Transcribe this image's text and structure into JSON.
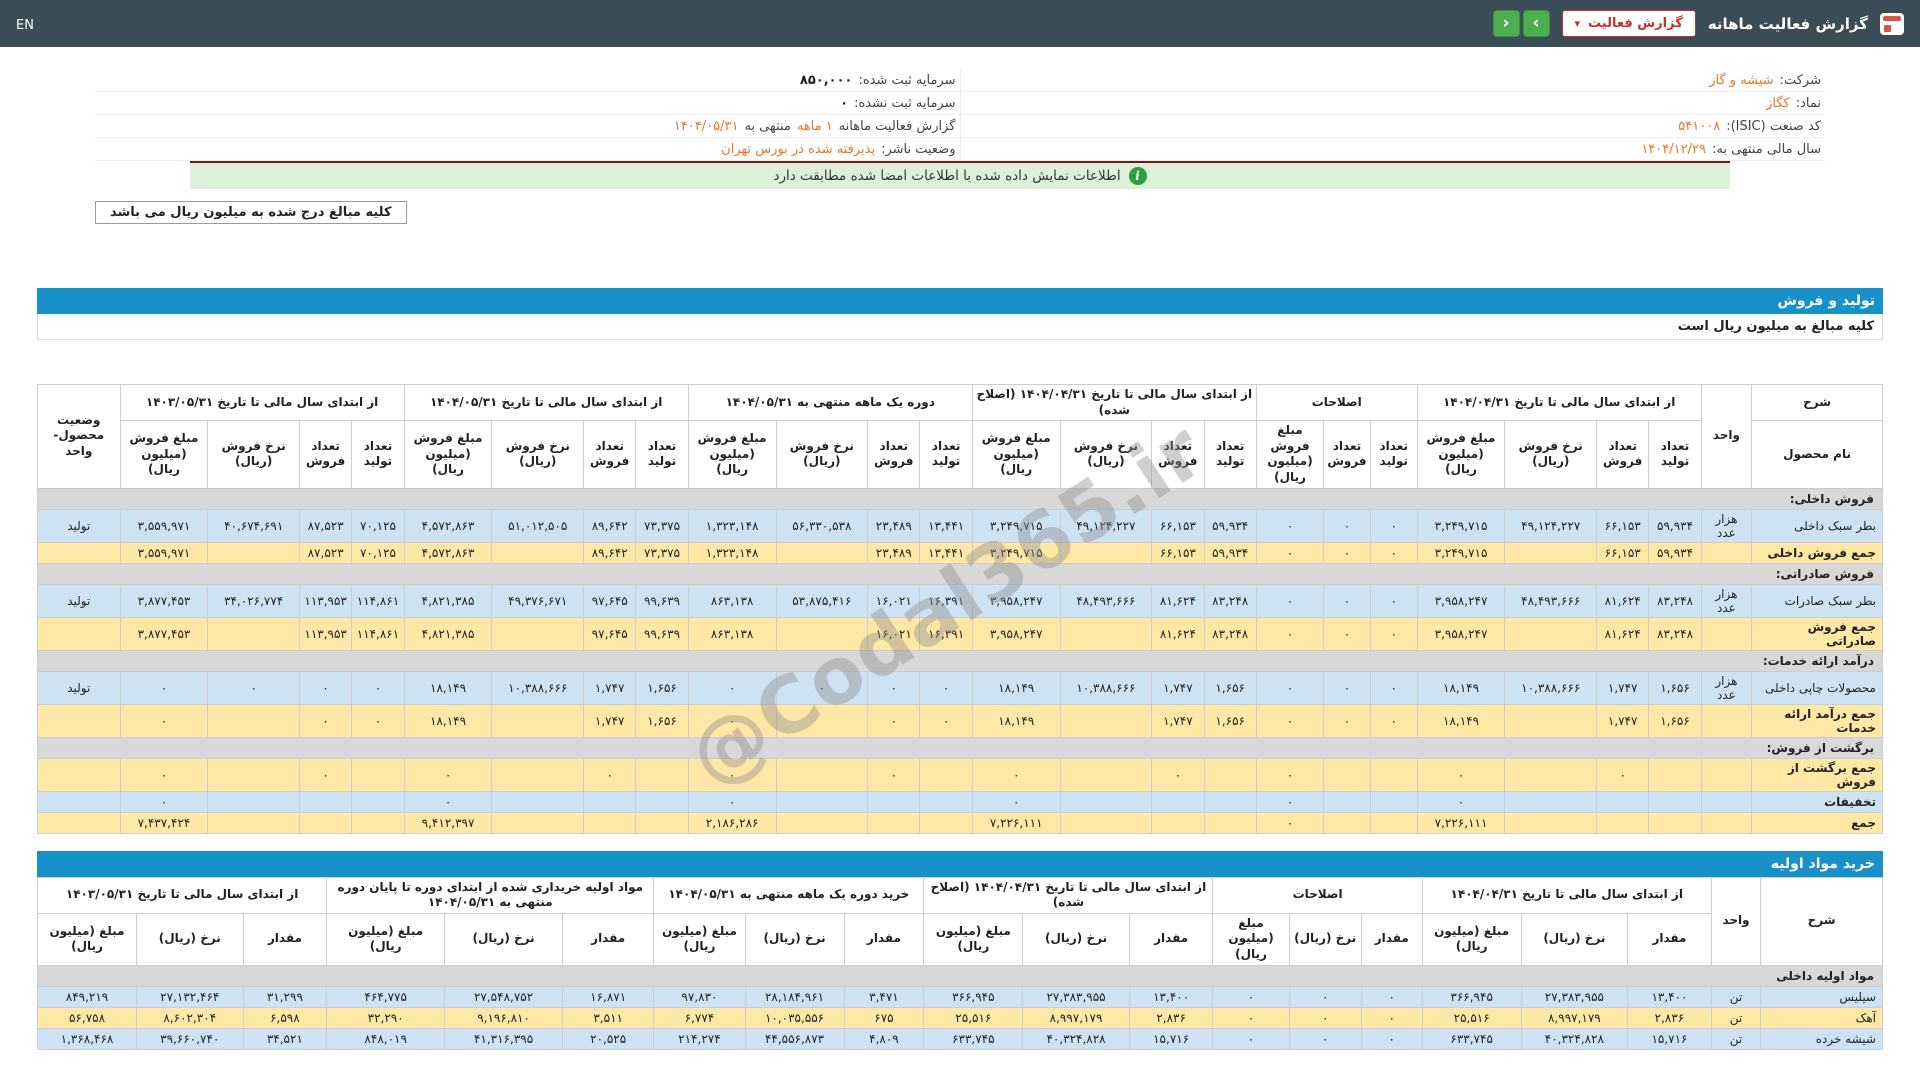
{
  "navbar": {
    "title": "گزارش فعالیت ماهانه",
    "report_button": "گزارش فعالیت",
    "caret": "▾",
    "next": "›",
    "prev": "‹",
    "lang": "EN"
  },
  "company": {
    "name_label": "شرکت:",
    "name": "شیشه و گاز",
    "symbol_label": "نماد:",
    "symbol": "کگاز",
    "isic_label": "کد صنعت (ISIC):",
    "isic": "۵۴۱۰۰۸",
    "fiscal_label": "سال مالی منتهی به:",
    "fiscal": "۱۴۰۴/۱۲/۲۹",
    "cap_reg_label": "سرمایه ثبت شده:",
    "cap_reg": "۸۵۰,۰۰۰",
    "cap_unreg_label": "سرمایه ثبت نشده:",
    "cap_unreg": "۰",
    "report_label": "گزارش فعالیت ماهانه",
    "report_period": "۱ ماهه",
    "report_mid": "منتهی به",
    "report_date": "۱۴۰۴/۰۵/۳۱",
    "status_label": "وضعیت ناشر:",
    "status": "پذیرفته شده در بورس تهران"
  },
  "notice": {
    "icon": "i",
    "text": "اطلاعات نمایش داده شده با اطلاعات امضا شده مطابقت دارد"
  },
  "amounts_box": "کلیه مبالغ درج شده به میلیون ریال می باشد",
  "sales_section": {
    "title": "تولید و فروش",
    "note": "کلیه مبالغ به میلیون ریال است"
  },
  "purchase_section": {
    "title": "خرید مواد اولیه"
  },
  "watermark": "@Codal365.ir",
  "sales_table": {
    "groups": [
      {
        "label": "شرح",
        "sub": [
          "نام محصول"
        ]
      },
      {
        "label": "واحد",
        "sub": null
      },
      {
        "label": "از ابتدای سال مالی تا تاریخ ۱۴۰۴/۰۴/۳۱",
        "sub": [
          "تعداد تولید",
          "تعداد فروش",
          "نرخ فروش (ریال)",
          "مبلغ فروش (میلیون ریال)"
        ]
      },
      {
        "label": "اصلاحات",
        "sub": [
          "تعداد تولید",
          "تعداد فروش",
          "مبلغ فروش (میلیون ریال)"
        ]
      },
      {
        "label": "از ابتدای سال مالی تا تاریخ ۱۴۰۴/۰۴/۳۱ (اصلاح شده)",
        "sub": [
          "تعداد تولید",
          "تعداد فروش",
          "نرخ فروش (ریال)",
          "مبلغ فروش (میلیون ریال)"
        ]
      },
      {
        "label": "دوره یک ماهه منتهی به ۱۴۰۴/۰۵/۳۱",
        "sub": [
          "تعداد تولید",
          "تعداد فروش",
          "نرخ فروش (ریال)",
          "مبلغ فروش (میلیون ریال)"
        ]
      },
      {
        "label": "از ابتدای سال مالی تا تاریخ ۱۴۰۴/۰۵/۳۱",
        "sub": [
          "تعداد تولید",
          "تعداد فروش",
          "نرخ فروش (ریال)",
          "مبلغ فروش (میلیون ریال)"
        ]
      },
      {
        "label": "از ابتدای سال مالی تا تاریخ ۱۴۰۳/۰۵/۳۱",
        "sub": [
          "تعداد تولید",
          "تعداد فروش",
          "نرخ فروش (ریال)",
          "مبلغ فروش (میلیون ریال)"
        ]
      },
      {
        "label": "وضعیت محصول-واحد",
        "sub": null
      }
    ],
    "rows": [
      {
        "type": "section",
        "label": "فروش داخلی:"
      },
      {
        "type": "data",
        "variant": "blue",
        "cells": [
          "بطر سبک داخلی",
          "هزار عدد",
          "۵۹,۹۳۴",
          "۶۶,۱۵۳",
          "۴۹,۱۲۴,۲۲۷",
          "۳,۲۴۹,۷۱۵",
          "۰",
          "۰",
          "۰",
          "۵۹,۹۳۴",
          "۶۶,۱۵۳",
          "۴۹,۱۲۴,۲۲۷",
          "۳,۲۴۹,۷۱۵",
          "۱۳,۴۴۱",
          "۲۳,۴۸۹",
          "۵۶,۳۳۰,۵۳۸",
          "۱,۳۲۳,۱۴۸",
          "۷۳,۳۷۵",
          "۸۹,۶۴۲",
          "۵۱,۰۱۲,۵۰۵",
          "۴,۵۷۲,۸۶۳",
          "۷۰,۱۲۵",
          "۸۷,۵۲۳",
          "۴۰,۶۷۴,۶۹۱",
          "۳,۵۵۹,۹۷۱",
          "تولید"
        ]
      },
      {
        "type": "data",
        "variant": "cream",
        "bold": true,
        "cells": [
          "جمع فروش داخلی",
          "",
          "۵۹,۹۳۴",
          "۶۶,۱۵۳",
          "",
          "۳,۲۴۹,۷۱۵",
          "۰",
          "۰",
          "۰",
          "۵۹,۹۳۴",
          "۶۶,۱۵۳",
          "",
          "۳,۲۴۹,۷۱۵",
          "۱۳,۴۴۱",
          "۲۳,۴۸۹",
          "",
          "۱,۳۲۳,۱۴۸",
          "۷۳,۳۷۵",
          "۸۹,۶۴۲",
          "",
          "۴,۵۷۲,۸۶۳",
          "۷۰,۱۲۵",
          "۸۷,۵۲۳",
          "",
          "۳,۵۵۹,۹۷۱",
          ""
        ]
      },
      {
        "type": "section",
        "label": "فروش صادراتی:"
      },
      {
        "type": "data",
        "variant": "blue",
        "cells": [
          "بطر سبک صادرات",
          "هزار عدد",
          "۸۳,۲۴۸",
          "۸۱,۶۲۴",
          "۴۸,۴۹۳,۶۶۶",
          "۳,۹۵۸,۲۴۷",
          "۰",
          "۰",
          "۰",
          "۸۳,۲۴۸",
          "۸۱,۶۲۴",
          "۴۸,۴۹۳,۶۶۶",
          "۳,۹۵۸,۲۴۷",
          "۱۶,۳۹۱",
          "۱۶,۰۲۱",
          "۵۳,۸۷۵,۴۱۶",
          "۸۶۳,۱۳۸",
          "۹۹,۶۳۹",
          "۹۷,۶۴۵",
          "۴۹,۳۷۶,۶۷۱",
          "۴,۸۲۱,۳۸۵",
          "۱۱۴,۸۶۱",
          "۱۱۳,۹۵۳",
          "۳۴,۰۲۶,۷۷۴",
          "۳,۸۷۷,۴۵۳",
          "تولید"
        ]
      },
      {
        "type": "data",
        "variant": "cream",
        "bold": true,
        "cells": [
          "جمع فروش صادراتی",
          "",
          "۸۳,۲۴۸",
          "۸۱,۶۲۴",
          "",
          "۳,۹۵۸,۲۴۷",
          "۰",
          "۰",
          "۰",
          "۸۳,۲۴۸",
          "۸۱,۶۲۴",
          "",
          "۳,۹۵۸,۲۴۷",
          "۱۶,۳۹۱",
          "۱۶,۰۲۱",
          "",
          "۸۶۳,۱۳۸",
          "۹۹,۶۳۹",
          "۹۷,۶۴۵",
          "",
          "۴,۸۲۱,۳۸۵",
          "۱۱۴,۸۶۱",
          "۱۱۳,۹۵۳",
          "",
          "۳,۸۷۷,۴۵۳",
          ""
        ]
      },
      {
        "type": "section",
        "label": "درآمد ارائه خدمات:"
      },
      {
        "type": "data",
        "variant": "blue",
        "cells": [
          "محصولات چاپی داخلی",
          "هزار عدد",
          "۱,۶۵۶",
          "۱,۷۴۷",
          "۱۰,۳۸۸,۶۶۶",
          "۱۸,۱۴۹",
          "۰",
          "۰",
          "۰",
          "۱,۶۵۶",
          "۱,۷۴۷",
          "۱۰,۳۸۸,۶۶۶",
          "۱۸,۱۴۹",
          "۰",
          "۰",
          "۰",
          "۰",
          "۱,۶۵۶",
          "۱,۷۴۷",
          "۱۰,۳۸۸,۶۶۶",
          "۱۸,۱۴۹",
          "۰",
          "۰",
          "۰",
          "۰",
          "تولید"
        ]
      },
      {
        "type": "data",
        "variant": "cream",
        "bold": true,
        "cells": [
          "جمع درآمد ارائه خدمات",
          "",
          "۱,۶۵۶",
          "۱,۷۴۷",
          "",
          "۱۸,۱۴۹",
          "۰",
          "۰",
          "۰",
          "۱,۶۵۶",
          "۱,۷۴۷",
          "",
          "۱۸,۱۴۹",
          "۰",
          "۰",
          "",
          "۰",
          "۱,۶۵۶",
          "۱,۷۴۷",
          "",
          "۱۸,۱۴۹",
          "۰",
          "۰",
          "",
          "۰",
          ""
        ]
      },
      {
        "type": "section",
        "label": "برگشت از فروش:"
      },
      {
        "type": "data",
        "variant": "cream",
        "bold": true,
        "cells": [
          "جمع برگشت از فروش",
          "",
          "",
          "۰",
          "",
          "۰",
          "",
          "",
          "۰",
          "",
          "۰",
          "",
          "۰",
          "",
          "۰",
          "",
          "۰",
          "",
          "۰",
          "",
          "۰",
          "",
          "۰",
          "",
          "۰",
          ""
        ]
      },
      {
        "type": "data",
        "variant": "blue",
        "bold": true,
        "cells": [
          "تخفیفات",
          "",
          "",
          "",
          "",
          "۰",
          "",
          "",
          "۰",
          "",
          "",
          "",
          "۰",
          "",
          "",
          "",
          "۰",
          "",
          "",
          "",
          "۰",
          "",
          "",
          "",
          "۰",
          ""
        ]
      },
      {
        "type": "data",
        "variant": "cream",
        "bold": true,
        "cells": [
          "جمع",
          "",
          "",
          "",
          "",
          "۷,۲۲۶,۱۱۱",
          "",
          "",
          "۰",
          "",
          "",
          "",
          "۷,۲۲۶,۱۱۱",
          "",
          "",
          "",
          "۲,۱۸۶,۲۸۶",
          "",
          "",
          "",
          "۹,۴۱۲,۳۹۷",
          "",
          "",
          "",
          "۷,۴۳۷,۴۲۴",
          ""
        ]
      }
    ]
  },
  "purchase_table": {
    "groups": [
      {
        "label": "شرح",
        "sub": null
      },
      {
        "label": "واحد",
        "sub": null
      },
      {
        "label": "از ابتدای سال مالی تا تاریخ ۱۴۰۴/۰۴/۳۱",
        "sub": [
          "مقدار",
          "نرخ (ریال)",
          "مبلغ (میلیون ریال)"
        ]
      },
      {
        "label": "اصلاحات",
        "sub": [
          "مقدار",
          "نرخ (ریال)",
          "مبلغ (میلیون ریال)"
        ]
      },
      {
        "label": "از ابتدای سال مالی تا تاریخ ۱۴۰۴/۰۴/۳۱ (اصلاح شده)",
        "sub": [
          "مقدار",
          "نرخ (ریال)",
          "مبلغ (میلیون ریال)"
        ]
      },
      {
        "label": "خرید دوره یک ماهه منتهی به ۱۴۰۴/۰۵/۳۱",
        "sub": [
          "مقدار",
          "نرخ (ریال)",
          "مبلغ (میلیون ریال)"
        ]
      },
      {
        "label": "مواد اولیه خریداری شده از ابتدای دوره تا پایان دوره منتهی به ۱۴۰۴/۰۵/۳۱",
        "sub": [
          "مقدار",
          "نرخ (ریال)",
          "مبلغ (میلیون ریال)"
        ]
      },
      {
        "label": "از ابتدای سال مالی تا تاریخ ۱۴۰۳/۰۵/۳۱",
        "sub": [
          "مقدار",
          "نرخ (ریال)",
          "مبلغ (میلیون ریال)"
        ]
      }
    ],
    "rows": [
      {
        "type": "section",
        "label": "مواد اولیه داخلی"
      },
      {
        "type": "data",
        "variant": "blue",
        "cells": [
          "سیلیس",
          "تن",
          "۱۳,۴۰۰",
          "۲۷,۳۸۳,۹۵۵",
          "۳۶۶,۹۴۵",
          "۰",
          "۰",
          "۰",
          "۱۳,۴۰۰",
          "۲۷,۳۸۳,۹۵۵",
          "۳۶۶,۹۴۵",
          "۳,۴۷۱",
          "۲۸,۱۸۴,۹۶۱",
          "۹۷,۸۳۰",
          "۱۶,۸۷۱",
          "۲۷,۵۴۸,۷۵۲",
          "۴۶۴,۷۷۵",
          "۳۱,۲۹۹",
          "۲۷,۱۳۲,۴۶۴",
          "۸۴۹,۲۱۹"
        ]
      },
      {
        "type": "data",
        "variant": "cream",
        "cells": [
          "آهک",
          "تن",
          "۲,۸۳۶",
          "۸,۹۹۷,۱۷۹",
          "۲۵,۵۱۶",
          "۰",
          "۰",
          "۰",
          "۲,۸۳۶",
          "۸,۹۹۷,۱۷۹",
          "۲۵,۵۱۶",
          "۶۷۵",
          "۱۰,۰۳۵,۵۵۶",
          "۶,۷۷۴",
          "۳,۵۱۱",
          "۹,۱۹۶,۸۱۰",
          "۳۲,۲۹۰",
          "۶,۵۹۸",
          "۸,۶۰۲,۳۰۴",
          "۵۶,۷۵۸"
        ]
      },
      {
        "type": "data",
        "variant": "blue",
        "cells": [
          "شیشه خرده",
          "تن",
          "۱۵,۷۱۶",
          "۴۰,۳۲۴,۸۲۸",
          "۶۳۳,۷۴۵",
          "۰",
          "۰",
          "۰",
          "۱۵,۷۱۶",
          "۴۰,۳۲۴,۸۲۸",
          "۶۳۳,۷۴۵",
          "۴,۸۰۹",
          "۴۴,۵۵۶,۸۷۳",
          "۲۱۴,۲۷۴",
          "۲۰,۵۲۵",
          "۴۱,۳۱۶,۳۹۵",
          "۸۴۸,۰۱۹",
          "۳۴,۵۲۱",
          "۳۹,۶۶۰,۷۴۰",
          "۱,۳۶۸,۴۶۸"
        ]
      }
    ]
  }
}
